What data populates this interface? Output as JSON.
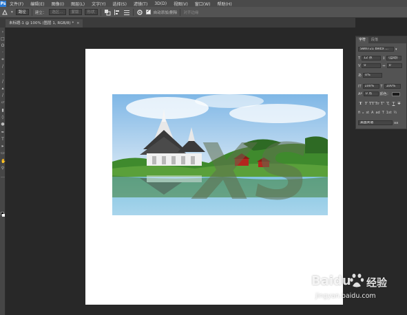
{
  "menubar": {
    "items": [
      "文件(F)",
      "编辑(E)",
      "图像(I)",
      "图层(L)",
      "文字(Y)",
      "选择(S)",
      "滤镜(T)",
      "3D(D)",
      "视图(V)",
      "窗口(W)",
      "帮助(H)"
    ]
  },
  "options": {
    "mode_select": "路径",
    "make_label": "建立：",
    "selection_btn": "选区...",
    "mask_btn": "蒙版",
    "shape_btn": "形状",
    "auto_add_delete": "自动添加/删除",
    "align_edges": "对齐边缘"
  },
  "document": {
    "tab_label": "未标题-1 @ 100% (图层 1, RGB/8) *",
    "close": "×"
  },
  "photo": {
    "overlay_text": "XS"
  },
  "character_panel": {
    "tabs": [
      "字符",
      "段落"
    ],
    "font_family": "Swis721 BlkEx ...",
    "font_size": "12 点",
    "leading": "(自动)",
    "kerning": "0",
    "tracking": "0",
    "scale_pct": "0%",
    "vertical_scale": "100%",
    "horizontal_scale": "100%",
    "baseline_shift": "0 点",
    "color_label": "颜色：",
    "style_buttons": [
      "T",
      "T",
      "TT",
      "Tr",
      "T'",
      "T,",
      "T",
      "T"
    ],
    "language": "美国英语",
    "aa_label": "aa"
  },
  "watermark": {
    "brand": "Baidu",
    "cn": "经验",
    "url": "jingyan.baidu.com"
  }
}
